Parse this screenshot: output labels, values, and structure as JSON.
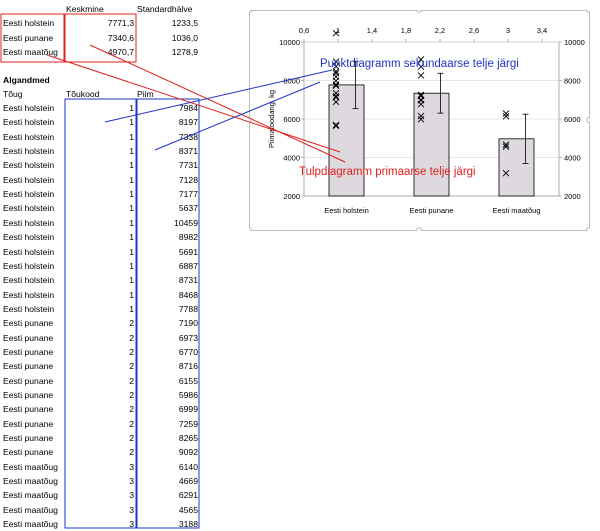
{
  "summary": {
    "headers": [
      "Keskmine",
      "Standardhälve"
    ],
    "rows": [
      {
        "breed": "Eesti holstein",
        "mean": "7771,3",
        "sd": "1233,5"
      },
      {
        "breed": "Eesti punane",
        "mean": "7340,6",
        "sd": "1036,0"
      },
      {
        "breed": "Eesti maatõug",
        "mean": "4970,7",
        "sd": "1278,9"
      }
    ]
  },
  "raw": {
    "title": "Algandmed",
    "headers": [
      "Tõug",
      "Tõukood",
      "Piim"
    ],
    "rows": [
      [
        "Eesti holstein",
        "1",
        "7984"
      ],
      [
        "Eesti holstein",
        "1",
        "8197"
      ],
      [
        "Eesti holstein",
        "1",
        "7338"
      ],
      [
        "Eesti holstein",
        "1",
        "8371"
      ],
      [
        "Eesti holstein",
        "1",
        "7731"
      ],
      [
        "Eesti holstein",
        "1",
        "7128"
      ],
      [
        "Eesti holstein",
        "1",
        "7177"
      ],
      [
        "Eesti holstein",
        "1",
        "5637"
      ],
      [
        "Eesti holstein",
        "1",
        "10459"
      ],
      [
        "Eesti holstein",
        "1",
        "8982"
      ],
      [
        "Eesti holstein",
        "1",
        "5691"
      ],
      [
        "Eesti holstein",
        "1",
        "6887"
      ],
      [
        "Eesti holstein",
        "1",
        "8731"
      ],
      [
        "Eesti holstein",
        "1",
        "8468"
      ],
      [
        "Eesti holstein",
        "1",
        "7788"
      ],
      [
        "Eesti punane",
        "2",
        "7190"
      ],
      [
        "Eesti punane",
        "2",
        "6973"
      ],
      [
        "Eesti punane",
        "2",
        "6770"
      ],
      [
        "Eesti punane",
        "2",
        "8716"
      ],
      [
        "Eesti punane",
        "2",
        "6155"
      ],
      [
        "Eesti punane",
        "2",
        "5986"
      ],
      [
        "Eesti punane",
        "2",
        "6999"
      ],
      [
        "Eesti punane",
        "2",
        "7259"
      ],
      [
        "Eesti punane",
        "2",
        "8265"
      ],
      [
        "Eesti punane",
        "2",
        "9092"
      ],
      [
        "Eesti maatõug",
        "3",
        "6140"
      ],
      [
        "Eesti maatõug",
        "3",
        "4669"
      ],
      [
        "Eesti maatõug",
        "3",
        "6291"
      ],
      [
        "Eesti maatõug",
        "3",
        "4565"
      ],
      [
        "Eesti maatõug",
        "3",
        "3188"
      ]
    ]
  },
  "annotations": {
    "scatter_label": "Punktdiagramm sekundaarse telje järgi",
    "bar_label": "Tulpdiagramm primaarse telje järgi"
  },
  "colors": {
    "blue": "#1f34c8",
    "red": "#e0201c",
    "bar_fill": "#ddd9df",
    "grid": "#dcdcdc"
  },
  "chart_data": {
    "type": "bar",
    "categories": [
      "Eesti holstein",
      "Eesti punane",
      "Eesti maatõug"
    ],
    "values": [
      7771.3,
      7340.6,
      4970.7
    ],
    "error": [
      1233.5,
      1036.0,
      1278.9
    ],
    "ylabel": "Piimatoodang, kg",
    "ylim": [
      2000,
      10000
    ],
    "yticks": [
      "2000",
      "4000",
      "6000",
      "8000",
      "10000"
    ],
    "y2lim": [
      2000,
      10000
    ],
    "y2ticks": [
      "2000",
      "4000",
      "6000",
      "8000",
      "10000"
    ],
    "x2lim": [
      0.6,
      3.6
    ],
    "x2ticks": [
      "0,6",
      "1",
      "1,4",
      "1,8",
      "2,2",
      "2,6",
      "3",
      "3,4"
    ],
    "grid": true,
    "scatter": {
      "x": [
        1,
        1,
        1,
        1,
        1,
        1,
        1,
        1,
        1,
        1,
        1,
        1,
        1,
        1,
        1,
        2,
        2,
        2,
        2,
        2,
        2,
        2,
        2,
        2,
        2,
        3,
        3,
        3,
        3,
        3
      ],
      "y": [
        7984,
        8197,
        7338,
        8371,
        7731,
        7128,
        7177,
        5637,
        10459,
        8982,
        5691,
        6887,
        8731,
        8468,
        7788,
        7190,
        6973,
        6770,
        8716,
        6155,
        5986,
        6999,
        7259,
        8265,
        9092,
        6140,
        4669,
        6291,
        4565,
        3188
      ]
    }
  }
}
